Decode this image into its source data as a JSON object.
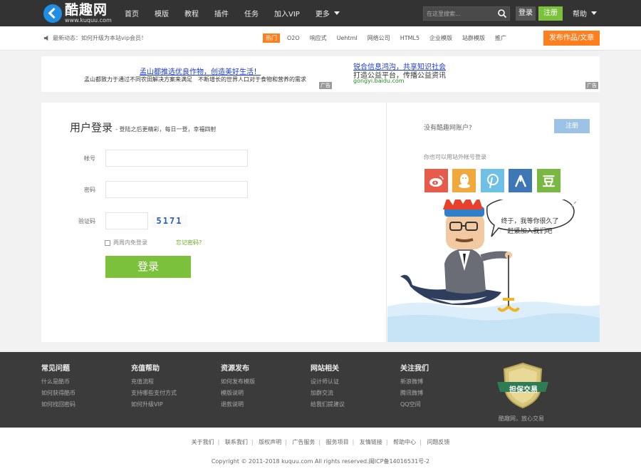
{
  "logo": {
    "name": "酷趣网",
    "url": "www.kuquu.com"
  },
  "nav": [
    "首页",
    "模版",
    "教程",
    "插件",
    "任务",
    "加入VIP",
    "更多"
  ],
  "search": {
    "placeholder": "在这里搜索..."
  },
  "top_buttons": {
    "login": "登录",
    "register": "注册",
    "help": "帮助"
  },
  "news": "最新动态：如何升级为本站vip会员！",
  "tags": {
    "hot": "热门",
    "items": [
      "O2O",
      "响应式",
      "Uehtml",
      "网络公司",
      "HTML5",
      "企业模版",
      "站群模版",
      "推广"
    ]
  },
  "publish_button": "发布作品/文章",
  "ads": [
    {
      "title": "孟山都推选优良作物，创造美好生活！",
      "desc": "孟山都致力于通过不同农田解决方案来满足　不断增长的世界人口对于食物和营养的需求",
      "url": "",
      "mark": "广告"
    },
    {
      "title": "锐合信息鸿沟，共享知识社会",
      "desc": "打造公益平台，传播公益资讯",
      "url": "gongyi.baidu.com",
      "mark": "广告"
    }
  ],
  "login": {
    "title": "用户登录",
    "subtitle": "- 登陆之后更精彩，每日一登，幸福四射",
    "account_label": "帐号",
    "password_label": "密码",
    "captcha_label": "验证码",
    "captcha_text": "5171",
    "remember": "两周内免登录",
    "forgot": "忘记密码?",
    "submit": "登录"
  },
  "side": {
    "no_account": "没有酷趣网账户?",
    "register": "注册",
    "other_login": "你也可以用站外帐号登录",
    "speech": "终于，我等你很久了\n赶紧加入我们吧",
    "socials": [
      {
        "name": "weibo",
        "color": "#e85b4b",
        "glyph": ""
      },
      {
        "name": "qq",
        "color": "#f2a93b",
        "glyph": ""
      },
      {
        "name": "pinterest",
        "color": "#6fc0e6",
        "glyph": ""
      },
      {
        "name": "renren",
        "color": "#3d77b6",
        "glyph": ""
      },
      {
        "name": "douban",
        "color": "#7ab844",
        "glyph": "豆"
      }
    ]
  },
  "footer": {
    "columns": [
      {
        "title": "常见问题",
        "items": [
          "什么是酷币",
          "如何获得酷币",
          "如何找回密码"
        ]
      },
      {
        "title": "充值帮助",
        "items": [
          "充值流程",
          "支持哪些支付方式",
          "如何升级VIP"
        ]
      },
      {
        "title": "资源发布",
        "items": [
          "如何发布模版",
          "模版说明",
          "退款说明"
        ]
      },
      {
        "title": "网站相关",
        "items": [
          "设计师认证",
          "加群交流",
          "给我们提建议"
        ]
      },
      {
        "title": "关注我们",
        "items": [
          "新浪微博",
          "腾讯微博",
          "QQ空间"
        ]
      }
    ],
    "badge_text": "担保交易",
    "badge_caption": "酷趣网，放心交易"
  },
  "bottom_links": [
    "关于我们",
    "联系我们",
    "版权声明",
    "广告服务",
    "服务项目",
    "友情链接",
    "帮助中心",
    "问题反馈"
  ],
  "copyright": "Copyright © 2011-2018 kuquu.com All rights reserved.闽ICP备14016531号-2"
}
